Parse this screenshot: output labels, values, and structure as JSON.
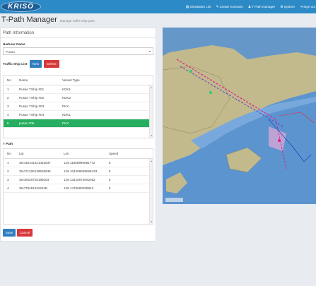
{
  "app": {
    "logo": "KRISO"
  },
  "nav": [
    {
      "label": "Simulation List",
      "icon": "list-icon"
    },
    {
      "label": "Create Scenario",
      "icon": "pencil-icon"
    },
    {
      "label": "T Path manager",
      "icon": "users-icon"
    },
    {
      "label": "System",
      "icon": "gear-icon"
    },
    {
      "label": "Sign out",
      "icon": "signout-icon"
    }
  ],
  "page": {
    "title": "T-Path Manager",
    "subtitle": "Manage traffic ship path"
  },
  "panel": {
    "heading": "Path Information"
  },
  "harbour": {
    "label": "Harbour Name",
    "value": "Pusan"
  },
  "ship_list": {
    "label": "Traffic Ship List",
    "new_label": "New",
    "delete_label": "Delete",
    "columns": [
      "No",
      "Name",
      "Vessel Type"
    ],
    "rows": [
      {
        "no": "1",
        "name": "Pusan TShip #01",
        "type": "KDK1"
      },
      {
        "no": "2",
        "name": "Pusan TShip #02",
        "type": "KDK2"
      },
      {
        "no": "3",
        "name": "Pusan TShip #03",
        "type": "PKX"
      },
      {
        "no": "4",
        "name": "Pusan TShip #04",
        "type": "KDK1"
      },
      {
        "no": "5",
        "name": "pusan #05",
        "type": "PKX"
      }
    ],
    "selected_index": 4,
    "selected_color": "#27ae60"
  },
  "tpath": {
    "label": "T Path",
    "columns": [
      "No",
      "Lat",
      "Lon",
      "Speed"
    ],
    "rows": [
      {
        "no": "1",
        "lat": "35.048141321053037",
        "lon": "129.11668995681772",
        "speed": "5"
      },
      {
        "no": "2",
        "lat": "35.071326138505636",
        "lon": "129.104499599065433",
        "speed": "5"
      },
      {
        "no": "3",
        "lat": "35.08326726195003",
        "lon": "129.13415674002062",
        "speed": "5"
      },
      {
        "no": "4",
        "lat": "35.078491022204B",
        "lon": "129.1470680035843",
        "speed": "5"
      }
    ]
  },
  "actions": {
    "save_label": "Save",
    "cancel_label": "Cancel"
  },
  "colors": {
    "topbar": "#2c8ac6",
    "primary": "#2f7fc2",
    "danger": "#d7393a",
    "sea": "#5b94cf",
    "land": "#c2b98c"
  }
}
